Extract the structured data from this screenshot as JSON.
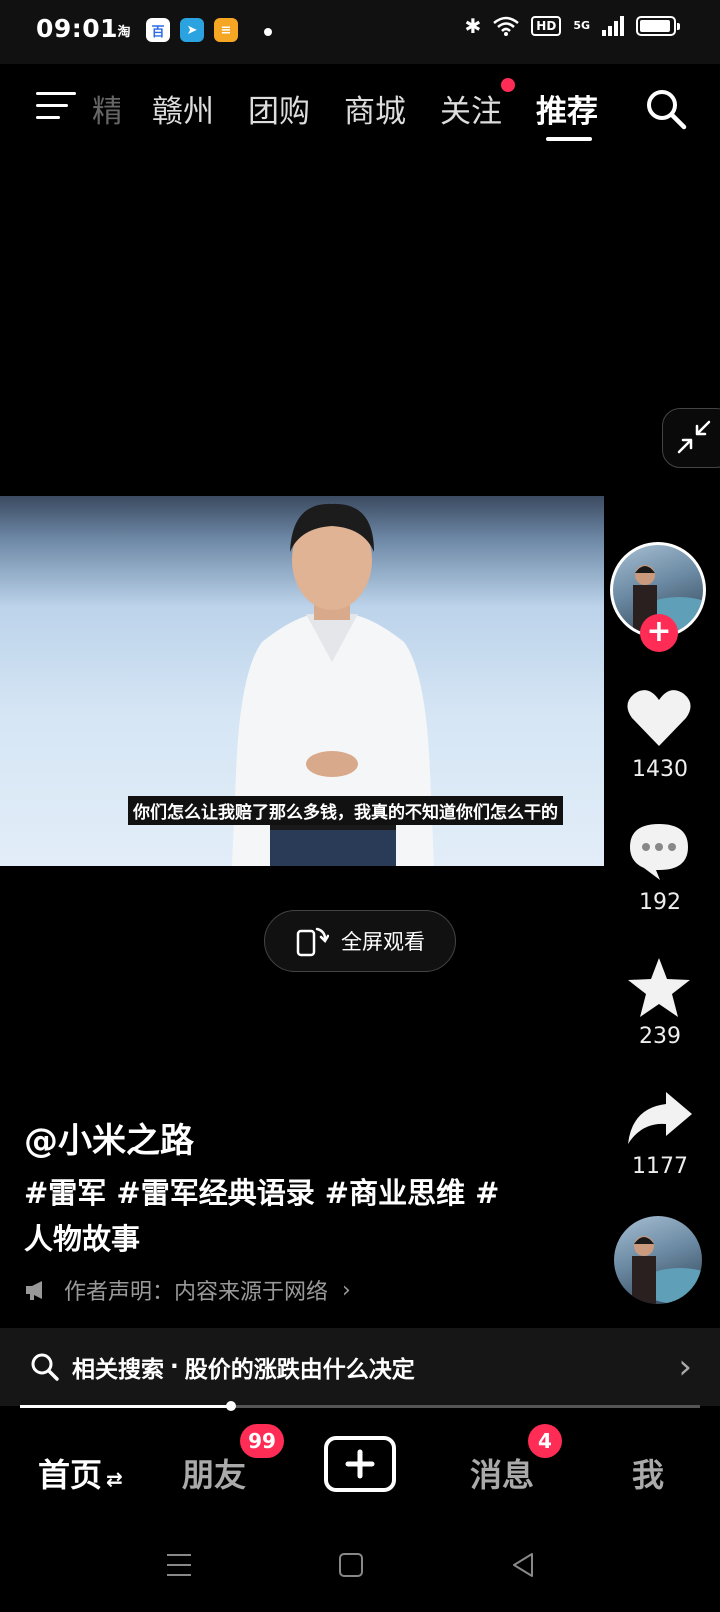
{
  "status_bar": {
    "time": "09:01",
    "apps": [
      {
        "name": "taobao-icon",
        "glyph": "淘"
      },
      {
        "name": "baidu-icon",
        "glyph": "百"
      },
      {
        "name": "telegram-icon",
        "glyph": "➤"
      },
      {
        "name": "wallet-icon",
        "glyph": "≡"
      }
    ],
    "hd": "HD",
    "network": "5G"
  },
  "top_nav": {
    "partial_tab": "精选",
    "tabs": [
      "赣州",
      "团购",
      "商城",
      "关注",
      "推荐"
    ],
    "active_tab": "推荐",
    "follow_has_notice": true
  },
  "video": {
    "subtitle": "你们怎么让我赔了那么多钱，我真的不知道你们怎么干的"
  },
  "fullscreen_button": {
    "label": "全屏观看"
  },
  "right_rail": {
    "like_count": "1430",
    "comment_count": "192",
    "favorite_count": "239",
    "share_count": "1177"
  },
  "caption": {
    "author": "@小米之路",
    "tags": "#雷军 #雷军经典语录 #商业思维 #人物故事",
    "declaration": "作者声明：内容来源于网络"
  },
  "related_search": {
    "prefix": "相关搜索",
    "separator": "·",
    "query": "股价的涨跌由什么决定"
  },
  "playback": {
    "progress": 0.31
  },
  "bottom_nav": {
    "home": "首页",
    "home_switch": "⇄",
    "friends": "朋友",
    "friends_badge": "99",
    "messages": "消息",
    "messages_badge": "4",
    "me": "我"
  },
  "colors": {
    "accent": "#ff2d55",
    "background": "#000000"
  }
}
